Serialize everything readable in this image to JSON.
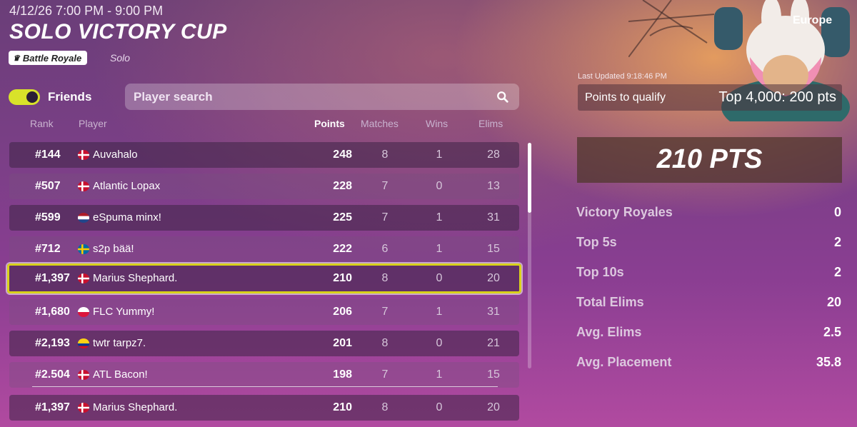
{
  "event": {
    "date": "4/12/26 7:00 PM - 9:00 PM",
    "title": "SOLO VICTORY CUP",
    "mode": "Battle Royale",
    "mode_sub": "Solo"
  },
  "filters": {
    "friends_label": "Friends",
    "friends_toggle_on": true,
    "search_placeholder": "Player search"
  },
  "columns": {
    "rank": "Rank",
    "player": "Player",
    "points": "Points",
    "matches": "Matches",
    "wins": "Wins",
    "elims": "Elims"
  },
  "rows": [
    {
      "rank": "#144",
      "flag": "denmark",
      "player": "Auvahalo",
      "points": "248",
      "matches": "8",
      "wins": "1",
      "elims": "28"
    },
    {
      "rank": "#507",
      "flag": "denmark",
      "player": "Atlantic Lopax",
      "points": "228",
      "matches": "7",
      "wins": "0",
      "elims": "13"
    },
    {
      "rank": "#599",
      "flag": "netherlands",
      "player": "eSpuma minx!",
      "points": "225",
      "matches": "7",
      "wins": "1",
      "elims": "31"
    },
    {
      "rank": "#712",
      "flag": "sweden",
      "player": "s2p bää!",
      "points": "222",
      "matches": "6",
      "wins": "1",
      "elims": "15"
    },
    {
      "rank": "#1,397",
      "flag": "denmark",
      "player": "Marius Shephard.",
      "points": "210",
      "matches": "8",
      "wins": "0",
      "elims": "20"
    },
    {
      "rank": "#1,680",
      "flag": "poland",
      "player": "FLC Yummy!",
      "points": "206",
      "matches": "7",
      "wins": "1",
      "elims": "31"
    },
    {
      "rank": "#2,193",
      "flag": "colombia",
      "player": "twtr tarpz7.",
      "points": "201",
      "matches": "8",
      "wins": "0",
      "elims": "21"
    },
    {
      "rank": "#2.504",
      "flag": "denmark",
      "player": "ATL Bacon!",
      "points": "198",
      "matches": "7",
      "wins": "1",
      "elims": "15"
    }
  ],
  "self_row": {
    "rank": "#1,397",
    "flag": "denmark",
    "player": "Marius Shephard.",
    "points": "210",
    "matches": "8",
    "wins": "0",
    "elims": "20"
  },
  "side": {
    "region": "Europe",
    "last_updated": "Last Updated 9:18:46 PM",
    "qualify_label": "Points to qualify",
    "qualify_value": "Top 4,000: 200 pts",
    "total_points": "210 PTS",
    "stats": [
      {
        "label": "Victory Royales",
        "value": "0"
      },
      {
        "label": "Top 5s",
        "value": "2"
      },
      {
        "label": "Top 10s",
        "value": "2"
      },
      {
        "label": "Total Elims",
        "value": "20"
      },
      {
        "label": "Avg. Elims",
        "value": "2.5"
      },
      {
        "label": "Avg. Placement",
        "value": "35.8"
      }
    ]
  },
  "colors": {
    "accent_yellow": "#d9d21a",
    "bg_purple": "#7a3f86"
  }
}
